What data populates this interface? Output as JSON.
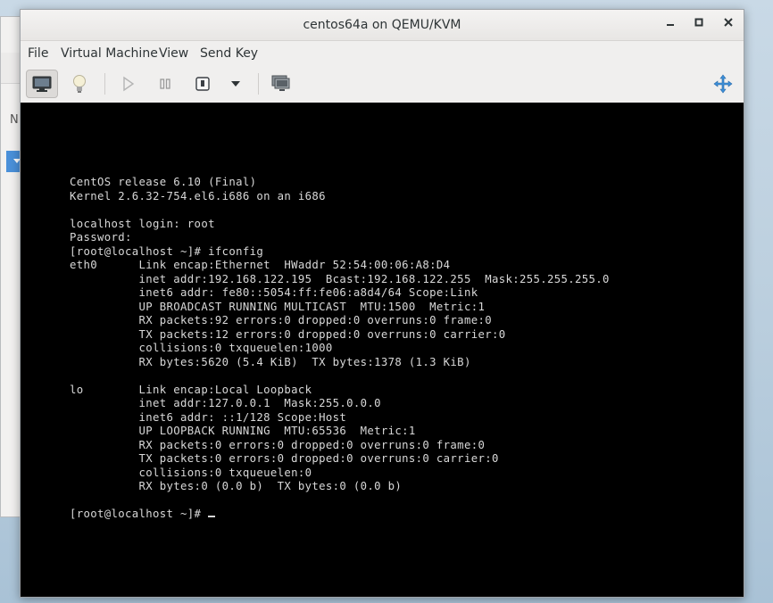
{
  "window": {
    "title": "centos64a on QEMU/KVM",
    "minimize_label": "_",
    "maximize_label": "□",
    "close_label": "✕"
  },
  "menu": {
    "items": [
      "File",
      "Virtual Machine",
      "View",
      "Send Key"
    ]
  },
  "toolbar": {
    "icons": [
      "monitor-icon",
      "lightbulb-icon",
      "play-icon",
      "pause-icon",
      "shutdown-icon",
      "dropdown-arrow-icon",
      "snapshot-icon",
      "fullscreen-move-icon"
    ]
  },
  "background_window": {
    "letter": "N"
  },
  "console": {
    "lines": [
      "CentOS release 6.10 (Final)",
      "Kernel 2.6.32-754.el6.i686 on an i686",
      "",
      "localhost login: root",
      "Password:",
      "[root@localhost ~]# ifconfig",
      "eth0      Link encap:Ethernet  HWaddr 52:54:00:06:A8:D4",
      "          inet addr:192.168.122.195  Bcast:192.168.122.255  Mask:255.255.255.0",
      "          inet6 addr: fe80::5054:ff:fe06:a8d4/64 Scope:Link",
      "          UP BROADCAST RUNNING MULTICAST  MTU:1500  Metric:1",
      "          RX packets:92 errors:0 dropped:0 overruns:0 frame:0",
      "          TX packets:12 errors:0 dropped:0 overruns:0 carrier:0",
      "          collisions:0 txqueuelen:1000",
      "          RX bytes:5620 (5.4 KiB)  TX bytes:1378 (1.3 KiB)",
      "",
      "lo        Link encap:Local Loopback",
      "          inet addr:127.0.0.1  Mask:255.0.0.0",
      "          inet6 addr: ::1/128 Scope:Host",
      "          UP LOOPBACK RUNNING  MTU:65536  Metric:1",
      "          RX packets:0 errors:0 dropped:0 overruns:0 frame:0",
      "          TX packets:0 errors:0 dropped:0 overruns:0 carrier:0",
      "          collisions:0 txqueuelen:0",
      "          RX bytes:0 (0.0 b)  TX bytes:0 (0.0 b)",
      "",
      "[root@localhost ~]# "
    ]
  }
}
